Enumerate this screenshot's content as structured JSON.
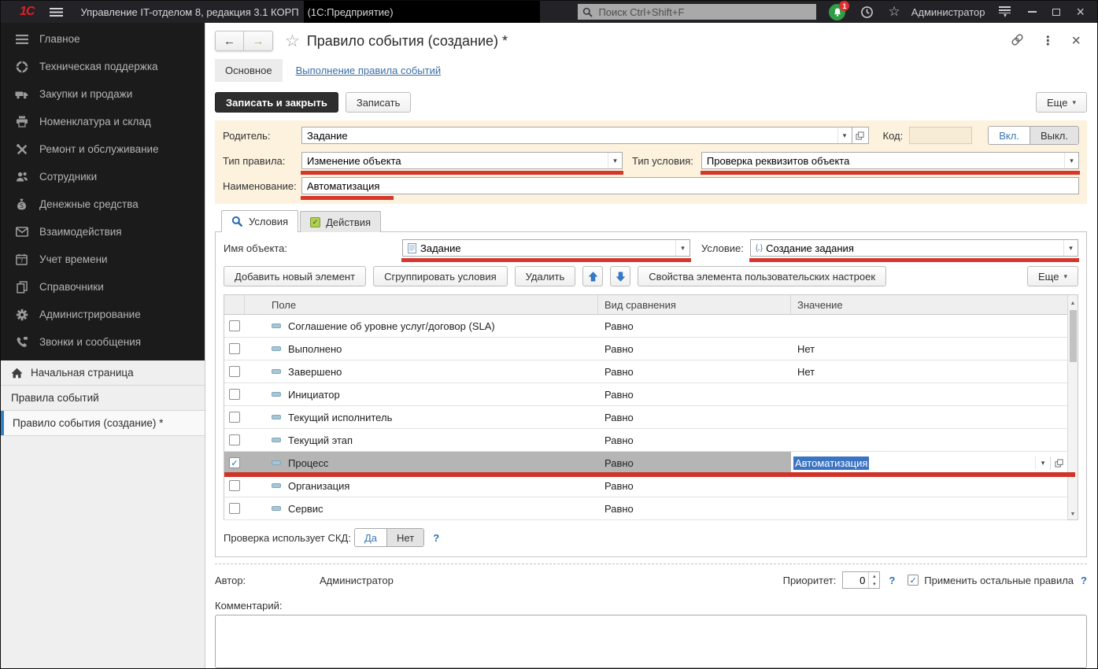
{
  "ui": {
    "help_glyph": "?"
  },
  "titlebar": {
    "logo": "1С",
    "app_title": "Управление IT-отделом 8, редакция 3.1 КОРП",
    "app_subtitle": "(1С:Предприятие)",
    "search_placeholder": "Поиск Ctrl+Shift+F",
    "notification_badge": "1",
    "user_name": "Администратор"
  },
  "sidebar": {
    "menu_items": [
      {
        "label": "Главное",
        "icon": "menu-lines-icon"
      },
      {
        "label": "Техническая поддержка",
        "icon": "support-ring-icon"
      },
      {
        "label": "Закупки и продажи",
        "icon": "truck-icon"
      },
      {
        "label": "Номенклатура и склад",
        "icon": "printer-icon"
      },
      {
        "label": "Ремонт и обслуживание",
        "icon": "tools-icon"
      },
      {
        "label": "Сотрудники",
        "icon": "people-icon"
      },
      {
        "label": "Денежные средства",
        "icon": "money-bag-icon"
      },
      {
        "label": "Взаимодействия",
        "icon": "envelope-icon"
      },
      {
        "label": "Учет времени",
        "icon": "calendar-icon"
      },
      {
        "label": "Справочники",
        "icon": "pages-icon"
      },
      {
        "label": "Администрирование",
        "icon": "gear-icon"
      },
      {
        "label": "Звонки и сообщения",
        "icon": "phone-icon"
      }
    ],
    "tabs": [
      {
        "label": "Начальная страница",
        "icon": "home-icon",
        "home": true
      },
      {
        "label": "Правила событий"
      },
      {
        "label": "Правило события (создание) *",
        "active": true
      }
    ]
  },
  "header": {
    "title": "Правило события (создание) *",
    "section_tab": "Основное",
    "link_tab": "Выполнение правила событий"
  },
  "commands": {
    "save_and_close": "Записать и закрыть",
    "save": "Записать",
    "more": "Еще"
  },
  "form": {
    "parent": {
      "label": "Родитель:",
      "value": "Задание"
    },
    "code": {
      "label": "Код:",
      "value": ""
    },
    "toggle_on": "Вкл.",
    "toggle_off": "Выкл.",
    "rule_type": {
      "label": "Тип правила:",
      "value": "Изменение объекта"
    },
    "condition_type": {
      "label": "Тип условия:",
      "value": "Проверка реквизитов объекта"
    },
    "name": {
      "label": "Наименование:",
      "value": "Автоматизация"
    }
  },
  "tabs": {
    "conditions": "Условия",
    "actions": "Действия"
  },
  "conditions": {
    "object_name": {
      "label": "Имя объекта:",
      "value": "Задание"
    },
    "condition": {
      "label": "Условие:",
      "value": "Создание задания"
    },
    "toolbar": {
      "buttons": [
        "Добавить новый элемент",
        "Сгруппировать условия",
        "Удалить"
      ],
      "props_button": "Свойства элемента пользовательских настроек",
      "more": "Еще"
    },
    "table": {
      "headers": [
        "Поле",
        "Вид сравнения",
        "Значение"
      ],
      "rows": [
        {
          "field": "Соглашение об уровне услуг/договор (SLA)",
          "comparison": "Равно",
          "value": "",
          "checked": false
        },
        {
          "field": "Выполнено",
          "comparison": "Равно",
          "value": "Нет",
          "checked": false
        },
        {
          "field": "Завершено",
          "comparison": "Равно",
          "value": "Нет",
          "checked": false
        },
        {
          "field": "Инициатор",
          "comparison": "Равно",
          "value": "",
          "checked": false
        },
        {
          "field": "Текущий исполнитель",
          "comparison": "Равно",
          "value": "",
          "checked": false
        },
        {
          "field": "Текущий этап",
          "comparison": "Равно",
          "value": "",
          "checked": false
        },
        {
          "field": "Процесс",
          "comparison": "Равно",
          "value": "Автоматизация",
          "checked": true,
          "selected": true
        },
        {
          "field": "Организация",
          "comparison": "Равно",
          "value": "",
          "checked": false
        },
        {
          "field": "Сервис",
          "comparison": "Равно",
          "value": "",
          "checked": false
        }
      ]
    },
    "skd": {
      "label": "Проверка использует СКД:",
      "yes": "Да",
      "no": "Нет"
    }
  },
  "footer": {
    "author_label": "Автор:",
    "author": "Администратор",
    "priority_label": "Приоритет:",
    "priority_value": "0",
    "apply_label": "Применить остальные правила",
    "comment_label": "Комментарий:"
  },
  "colors": {
    "accent_blue": "#3a76b8",
    "annotation_red": "#d6372c",
    "panel_beige": "#fcf2dd",
    "selection_blue": "#3c74c4",
    "notification_green": "#2f9e44",
    "badge_red": "#e03131"
  }
}
